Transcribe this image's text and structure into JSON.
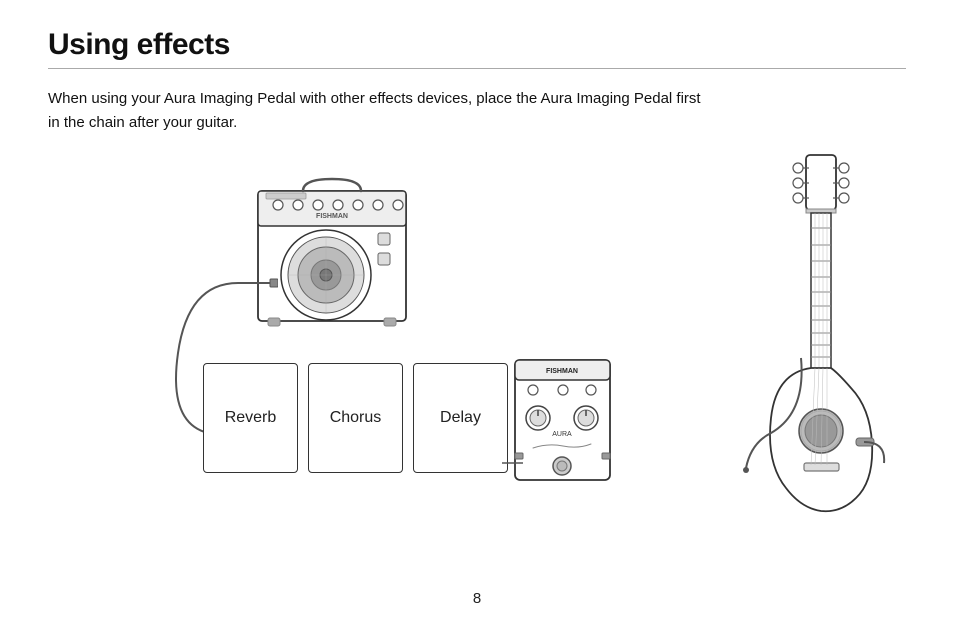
{
  "page": {
    "title": "Using effects",
    "description": "When using your Aura Imaging Pedal with other effects devices, place the Aura Imaging Pedal first in the chain after your guitar.",
    "page_number": "8",
    "pedals": [
      {
        "label": "Reverb"
      },
      {
        "label": "Chorus"
      },
      {
        "label": "Delay"
      }
    ]
  }
}
